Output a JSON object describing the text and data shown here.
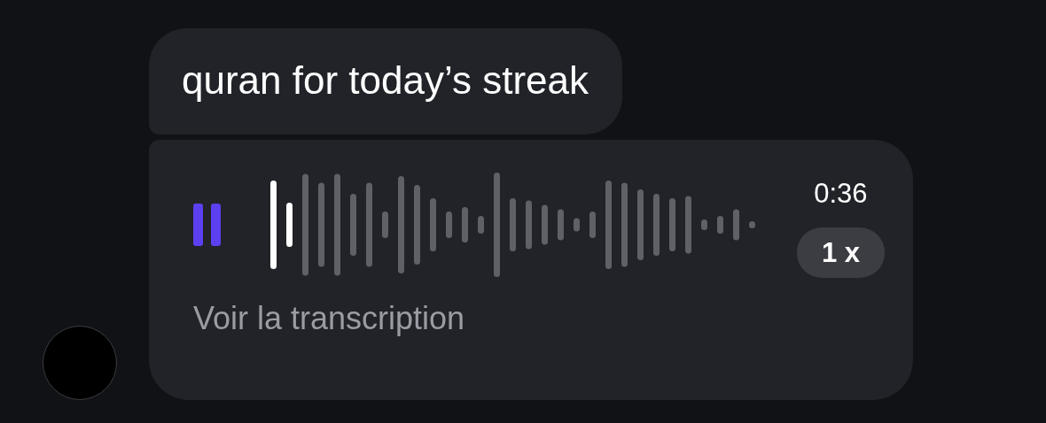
{
  "messages": [
    {
      "kind": "text",
      "text": "quran for today’s streak"
    },
    {
      "kind": "voice",
      "playing": true,
      "level": 0.06,
      "duration": "0:36",
      "speed": "1 x",
      "transcript_link": "Voir la transcription"
    }
  ],
  "avatar": {
    "kind": "blank"
  }
}
